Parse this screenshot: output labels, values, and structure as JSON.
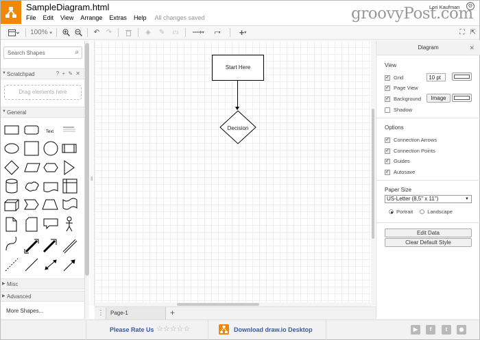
{
  "app": {
    "title": "SampleDiagram.html",
    "menus": [
      "File",
      "Edit",
      "View",
      "Arrange",
      "Extras",
      "Help"
    ],
    "status": "All changes saved",
    "watermark": "groovyPost.com",
    "user": "Lori Kaufman"
  },
  "toolbar": {
    "zoom": "100%",
    "zoom_caret": "▾",
    "icons": [
      "page-view-icon",
      "zoom-in-icon",
      "zoom-out-icon",
      "undo-icon",
      "redo-icon",
      "delete-icon",
      "fill-color-icon",
      "line-color-icon",
      "shadow-icon",
      "connection-icon",
      "waypoints-icon",
      "insert-icon",
      "fullscreen-icon",
      "collapse-icon"
    ]
  },
  "left_panel": {
    "search_placeholder": "Search Shapes",
    "scratchpad": {
      "label": "Scratchpad",
      "tools": "? + ✎ ✕",
      "drag_hint": "Drag elements here"
    },
    "general_label": "General",
    "shape_text_label": "Text",
    "misc_label": "Misc",
    "advanced_label": "Advanced",
    "more_shapes": "More Shapes..."
  },
  "canvas": {
    "start_node": "Start Here",
    "decision_node": "Decision"
  },
  "page_bar": {
    "tab": "Page-1",
    "add": "+"
  },
  "right_panel": {
    "title": "Diagram",
    "view_heading": "View",
    "grid_label": "Grid",
    "grid_size": "10 pt",
    "page_view_label": "Page View",
    "background_label": "Background",
    "image_button": "Image",
    "shadow_label": "Shadow",
    "options_heading": "Options",
    "connection_arrows": "Connection Arrows",
    "connection_points": "Connection Points",
    "guides": "Guides",
    "autosave": "Autosave",
    "paper_heading": "Paper Size",
    "paper_size": "US-Letter (8,5\" x 11\")",
    "portrait": "Portrait",
    "landscape": "Landscape",
    "edit_data": "Edit Data",
    "clear_style": "Clear Default Style",
    "checks": {
      "grid": true,
      "page_view": true,
      "background": true,
      "shadow": false,
      "arrows": true,
      "points": true,
      "guides": true,
      "autosave": true
    }
  },
  "footer": {
    "rate": "Please Rate Us",
    "stars": "☆☆☆☆☆",
    "download": "Download draw.io Desktop"
  },
  "colors": {
    "brand": "#f08705",
    "link": "#3b5998"
  }
}
